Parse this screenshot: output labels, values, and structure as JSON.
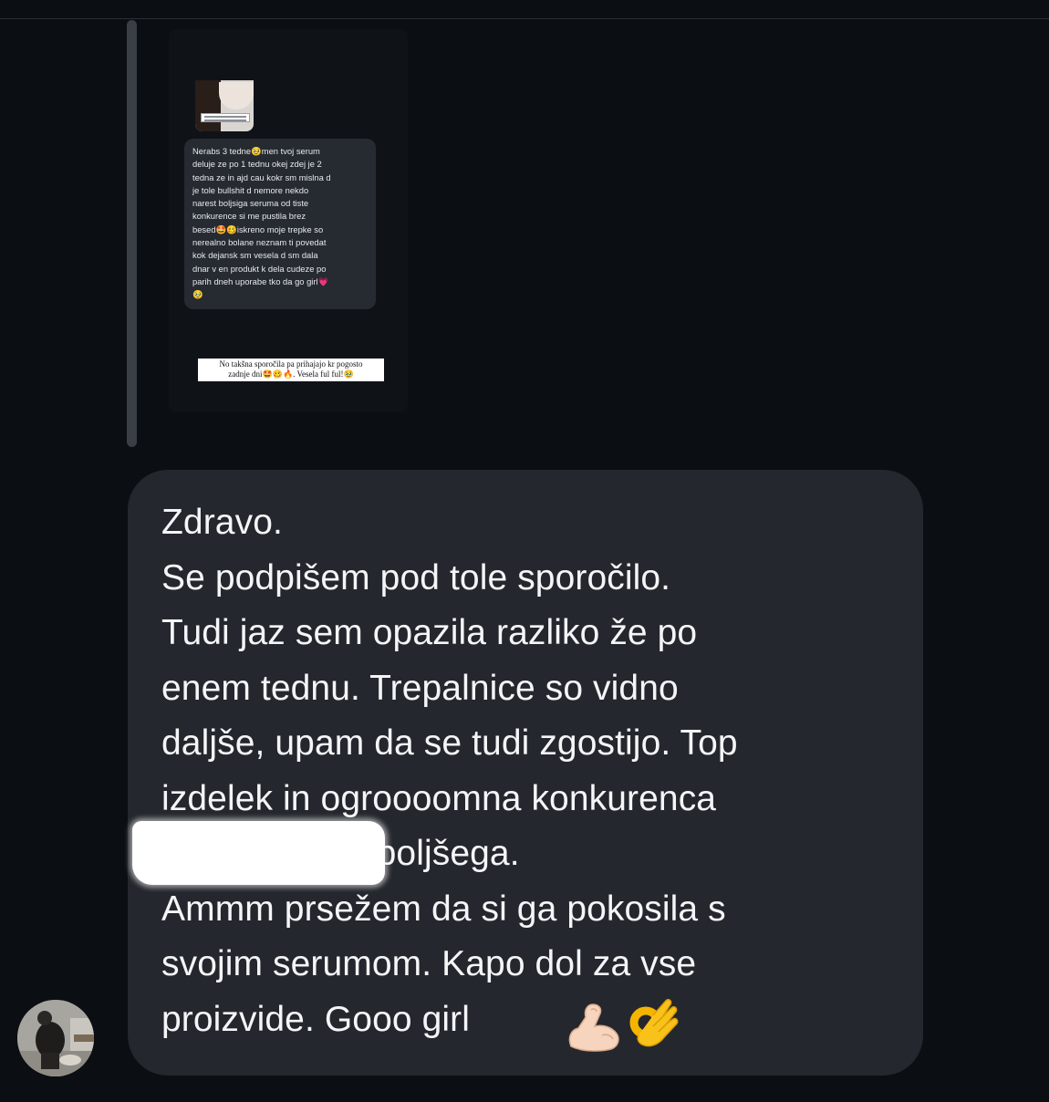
{
  "reply_preview": {
    "story_caption": "No takšna sporočila pa prihajajo kr pogosto\nzadnje dni🤩🥴🔥. Vesela ful ful!🥹",
    "quoted_message": "Nerabs 3 tedne🥹men tvoj serum\ndeluje ze po 1 tednu okej zdej je 2\ntedna ze in ajd cau kokr sm mislna d\nje tole bullshit d nemore nekdo\nnarest boljsiga seruma od tiste\nkonkurence si me pustila brez\nbesed🤩🥴iskreno moje trepke so\nnerealno bolane neznam ti povedat\nkok dejansk sm vesela d sm dala\ndnar v en produkt k dela cudeze po\nparih dneh uporabe tko da go girl💗\n🥹"
  },
  "message": {
    "text": "Zdravo.\nSe podpišem pod tole sporočilo.\nTudi jaz sem opazila razliko že po\nenem tednu. Trepalnice so vidno\ndaljše, upam da se tudi zgostijo. Top\nizdelek in ogroooomna konkurenca\n                              ki velja za najboljšega.\nAmmm prsežem da si ga pokosila s\nsvojim serumom. Kapo dol za vse\nproizvide. Gooo girl",
    "emojis": [
      "flexed-biceps-icon",
      "ok-hand-icon"
    ]
  },
  "colors": {
    "background": "#0b0e12",
    "bubble": "#24272d",
    "text": "#f4f5f7",
    "reply_bar": "#3a3f46"
  }
}
